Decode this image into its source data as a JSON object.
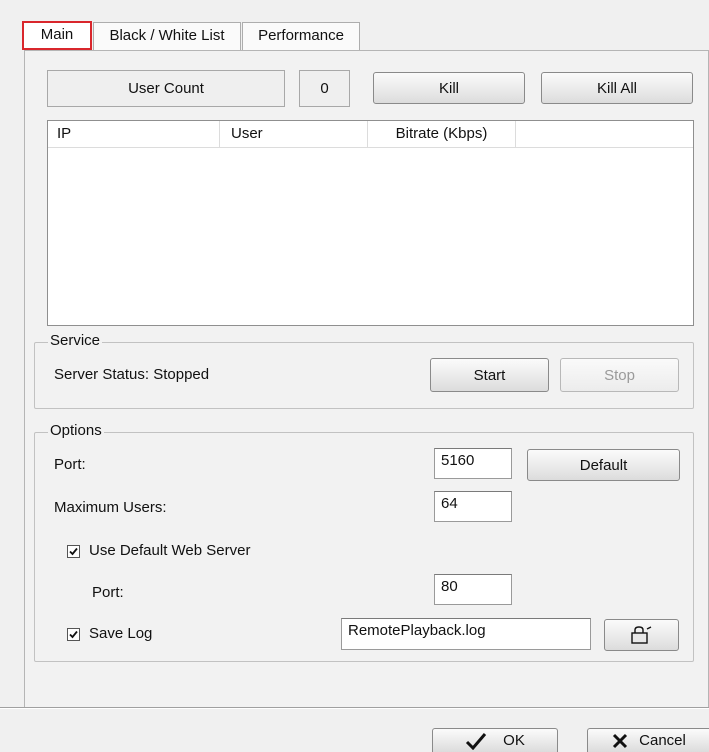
{
  "tabs": [
    {
      "label": "Main"
    },
    {
      "label": "Black / White List"
    },
    {
      "label": "Performance"
    }
  ],
  "top": {
    "user_count_label": "User Count",
    "user_count_value": "0",
    "kill_label": "Kill",
    "kill_all_label": "Kill All"
  },
  "table": {
    "columns": [
      "IP",
      "User",
      "Bitrate (Kbps)"
    ],
    "rows": []
  },
  "service": {
    "title": "Service",
    "status_text": "Server Status: Stopped",
    "start_label": "Start",
    "stop_label": "Stop"
  },
  "options": {
    "title": "Options",
    "port_label": "Port:",
    "port_value": "5160",
    "default_label": "Default",
    "max_users_label": "Maximum Users:",
    "max_users_value": "64",
    "use_web_server_label": "Use Default Web Server",
    "use_web_server_checked": true,
    "web_port_label": "Port:",
    "web_port_value": "80",
    "save_log_label": "Save Log",
    "save_log_checked": true,
    "log_file_value": "RemotePlayback.log",
    "browse_icon": "open-folder-icon"
  },
  "footer": {
    "ok_label": "OK",
    "cancel_label": "Cancel"
  }
}
